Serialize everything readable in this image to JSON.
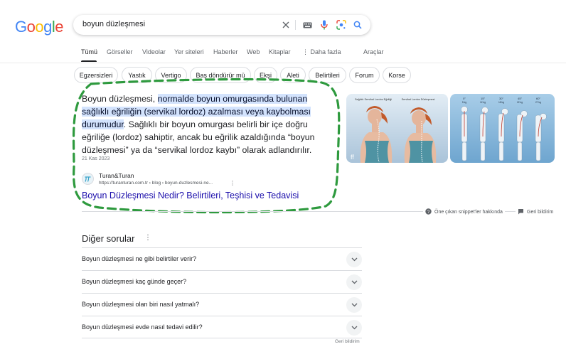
{
  "logo": {
    "letters": [
      "G",
      "o",
      "o",
      "g",
      "l",
      "e"
    ],
    "colors": [
      "#4285F4",
      "#EA4335",
      "#FBBC05",
      "#4285F4",
      "#34A853",
      "#EA4335"
    ]
  },
  "search": {
    "query": "boyun düzleşmesi"
  },
  "icons": {
    "clear": "close-icon",
    "keyboard": "keyboard-icon",
    "mic": "mic-icon",
    "lens": "lens-icon",
    "search": "search-icon"
  },
  "tabs": [
    "Tümü",
    "Görseller",
    "Videolar",
    "Yer siteleri",
    "Haberler",
    "Web",
    "Kitaplar",
    "Daha fazla",
    "Araçlar"
  ],
  "chips": [
    "Egzersizleri",
    "Yastık",
    "Vertigo",
    "Baş döndürür mü",
    "Ekşi",
    "Aleti",
    "Belirtileri",
    "Forum",
    "Korse"
  ],
  "snippet": {
    "text_pre": "Boyun düzleşmesi, ",
    "text_highlight": "normalde boyun omurgasında bulunan sağlıklı eğriliğin (servikal lordoz) azalması veya kaybolması durumudur",
    "text_post": ". Sağlıklı bir boyun omurgası belirli bir içe doğru eğriliğe (lordoz) sahiptir, ancak bu eğrilik azaldığında “boyun düzleşmesi” ya da “servikal lordoz kaybı” olarak adlandırılır.",
    "date": "21 Kas 2023",
    "source_name": "Turan&Turan",
    "source_url": "https://turanturan.com.tr › blog › boyun-duzlesmesi-ne...",
    "title": "Boyun Düzleşmesi Nedir? Belirtileri, Teşhisi ve Tedavisi",
    "image1_labels": [
      "Sağlıklı Servikal Lordoz Eğriliği",
      "Servikal Lordoz Düzleşmesi"
    ],
    "image2_angles": [
      "0°",
      "15°",
      "30°",
      "45°",
      "60°"
    ],
    "image2_weights": [
      "5 kg",
      "12 kg",
      "18 kg",
      "22 kg",
      "27 kg"
    ],
    "about": "Öne çıkan snippet'ler hakkında",
    "feedback": "Geri bildirim"
  },
  "paa": {
    "title": "Diğer sorular",
    "questions": [
      "Boyun düzleşmesi ne gibi belirtiler verir?",
      "Boyun düzleşmesi kaç günde geçer?",
      "Boyun düzleşmesi olan biri nasıl yatmalı?",
      "Boyun düzleşmesi evde nasıl tedavi edilir?"
    ],
    "feedback": "Geri bildirim"
  },
  "colors": {
    "link": "#1a0dab",
    "highlight": "#d3e3fd",
    "annotation": "#2e9a3e"
  }
}
